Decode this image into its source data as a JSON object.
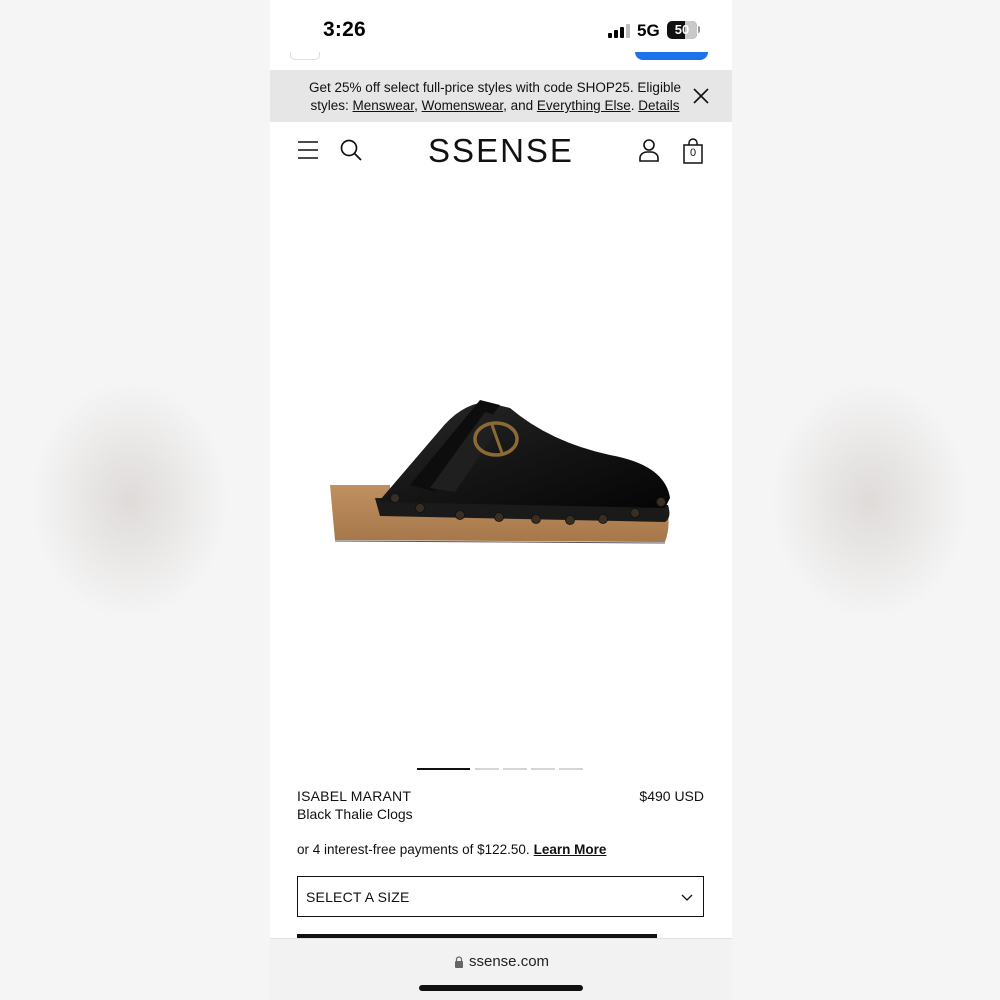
{
  "status_bar": {
    "time": "3:26",
    "network": "5G",
    "battery": "50"
  },
  "promo": {
    "text_before": "Get 25% off select full-price styles with code SHOP25. Eligible styles: ",
    "links": [
      "Menswear",
      "Womenswear",
      "Everything Else",
      "Details"
    ],
    "sep1": ", ",
    "sep2": ", and ",
    "sep3": ". "
  },
  "nav": {
    "logo": "SSENSE",
    "bag_count": "0"
  },
  "icons": [
    "menu-icon",
    "search-icon",
    "account-icon",
    "bag-icon",
    "close-icon",
    "lock-icon",
    "chevron-down-icon"
  ],
  "carousel": {
    "total": 5,
    "active": 1
  },
  "product": {
    "brand": "ISABEL MARANT",
    "name": "Black Thalie Clogs",
    "price": "$490 USD",
    "installments": "or 4 interest-free payments of $122.50.",
    "learn_more": "Learn More"
  },
  "size_select": {
    "label": "SELECT A SIZE"
  },
  "browser": {
    "url": "ssense.com"
  }
}
